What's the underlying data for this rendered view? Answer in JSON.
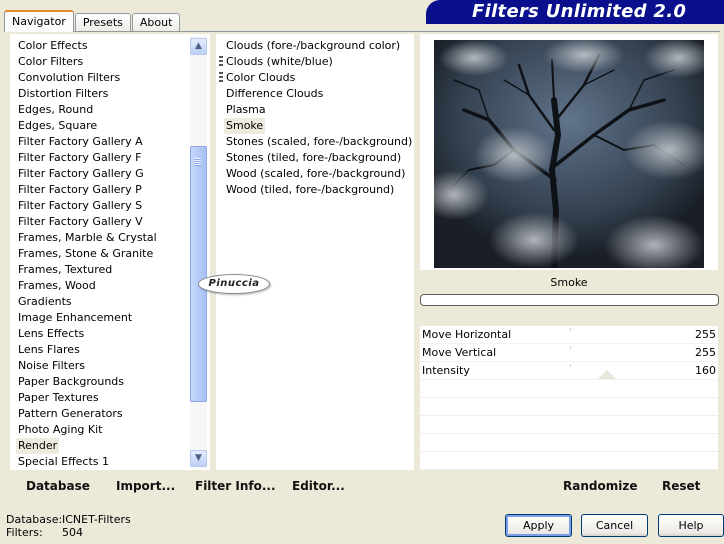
{
  "tabs": [
    {
      "label": "Navigator"
    },
    {
      "label": "Presets"
    },
    {
      "label": "About"
    }
  ],
  "banner": {
    "title": "Filters Unlimited 2.0"
  },
  "categories": [
    "Color Effects",
    "Color Filters",
    "Convolution Filters",
    "Distortion Filters",
    "Edges, Round",
    "Edges, Square",
    "Filter Factory Gallery A",
    "Filter Factory Gallery F",
    "Filter Factory Gallery G",
    "Filter Factory Gallery P",
    "Filter Factory Gallery S",
    "Filter Factory Gallery V",
    "Frames, Marble & Crystal",
    "Frames, Stone & Granite",
    "Frames, Textured",
    "Frames, Wood",
    "Gradients",
    "Image Enhancement",
    "Lens Effects",
    "Lens Flares",
    "Noise Filters",
    "Paper Backgrounds",
    "Paper Textures",
    "Pattern Generators",
    "Photo Aging Kit",
    "Render",
    "Special Effects 1"
  ],
  "selected_category": "Render",
  "filters": [
    {
      "label": "Clouds (fore-/background color)",
      "grip": false
    },
    {
      "label": "Clouds (white/blue)",
      "grip": true
    },
    {
      "label": "Color Clouds",
      "grip": true
    },
    {
      "label": "Difference Clouds",
      "grip": false
    },
    {
      "label": "Plasma",
      "grip": false
    },
    {
      "label": "Smoke",
      "grip": false
    },
    {
      "label": "Stones (scaled, fore-/background)",
      "grip": false
    },
    {
      "label": "Stones (tiled, fore-/background)",
      "grip": false
    },
    {
      "label": "Wood (scaled, fore-/background)",
      "grip": false
    },
    {
      "label": "Wood (tiled, fore-/background)",
      "grip": false
    }
  ],
  "selected_filter": "Smoke",
  "watermark": "Pinuccia",
  "preview": {
    "filter_name": "Smoke"
  },
  "params": [
    {
      "name": "Move Horizontal",
      "value": "255"
    },
    {
      "name": "Move Vertical",
      "value": "255"
    },
    {
      "name": "Intensity",
      "value": "160"
    }
  ],
  "toolbar_left": {
    "database": "Database",
    "import": "Import...",
    "filter_info": "Filter Info...",
    "editor": "Editor..."
  },
  "toolbar_right": {
    "randomize": "Randomize",
    "reset": "Reset"
  },
  "status": {
    "database_label": "Database:",
    "database_value": "ICNET-Filters",
    "filters_label": "Filters:",
    "filters_value": "504"
  },
  "buttons": {
    "apply": "Apply",
    "cancel": "Cancel",
    "help": "Help"
  },
  "colors": {
    "banner": "#0a108d",
    "selection": "#eeeae0",
    "dialog_bg": "#ece9d8"
  }
}
